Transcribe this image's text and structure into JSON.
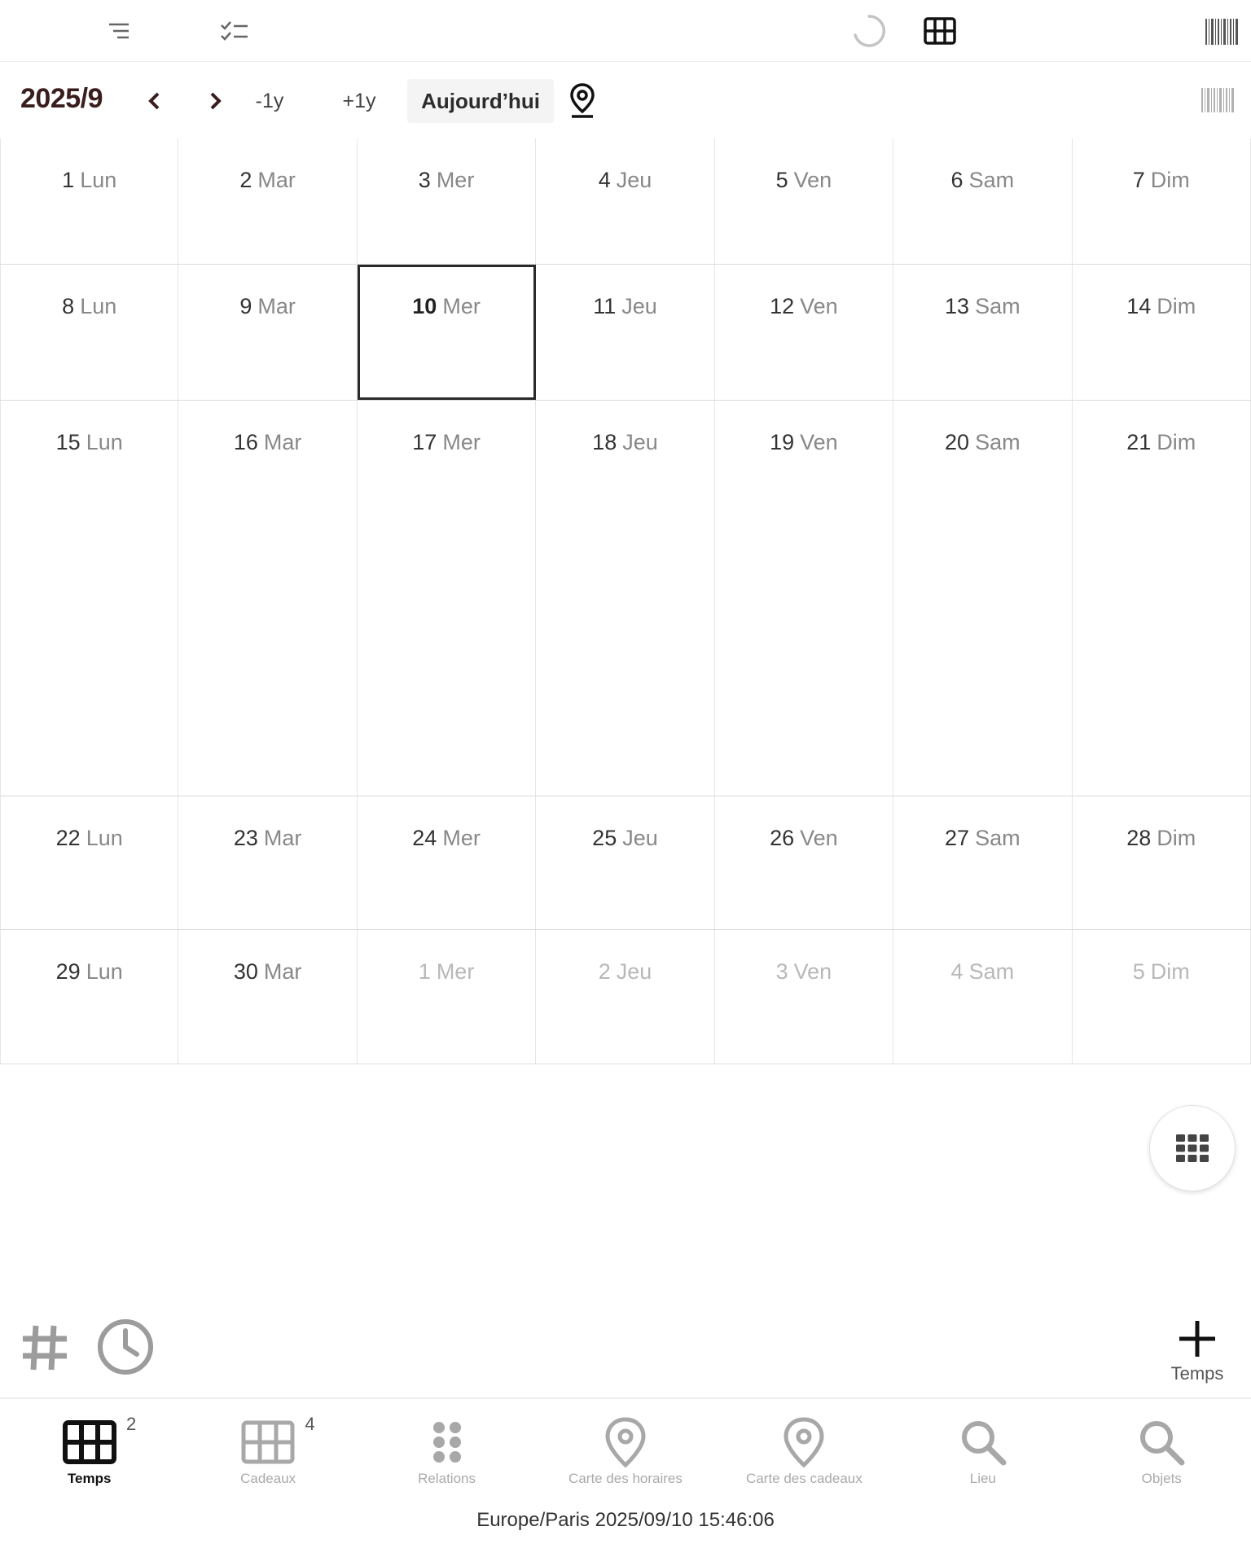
{
  "toolbar": {
    "icons": [
      "list-icon",
      "checklist-icon",
      "loading-spinner-icon",
      "grid-view-icon",
      "barcode-icon"
    ]
  },
  "nav": {
    "month_title": "2025/9",
    "prev_label": "‹",
    "next_label": "›",
    "minus_year": "-1y",
    "plus_year": "+1y",
    "today": "Aujourd’hui"
  },
  "calendar": {
    "weeks": [
      [
        {
          "n": "1",
          "d": "Lun"
        },
        {
          "n": "2",
          "d": "Mar"
        },
        {
          "n": "3",
          "d": "Mer"
        },
        {
          "n": "4",
          "d": "Jeu"
        },
        {
          "n": "5",
          "d": "Ven"
        },
        {
          "n": "6",
          "d": "Sam"
        },
        {
          "n": "7",
          "d": "Dim"
        }
      ],
      [
        {
          "n": "8",
          "d": "Lun"
        },
        {
          "n": "9",
          "d": "Mar"
        },
        {
          "n": "10",
          "d": "Mer",
          "today": true
        },
        {
          "n": "11",
          "d": "Jeu"
        },
        {
          "n": "12",
          "d": "Ven"
        },
        {
          "n": "13",
          "d": "Sam"
        },
        {
          "n": "14",
          "d": "Dim"
        }
      ],
      [
        {
          "n": "15",
          "d": "Lun"
        },
        {
          "n": "16",
          "d": "Mar"
        },
        {
          "n": "17",
          "d": "Mer"
        },
        {
          "n": "18",
          "d": "Jeu"
        },
        {
          "n": "19",
          "d": "Ven"
        },
        {
          "n": "20",
          "d": "Sam"
        },
        {
          "n": "21",
          "d": "Dim"
        }
      ],
      [
        {
          "n": "22",
          "d": "Lun"
        },
        {
          "n": "23",
          "d": "Mar"
        },
        {
          "n": "24",
          "d": "Mer"
        },
        {
          "n": "25",
          "d": "Jeu"
        },
        {
          "n": "26",
          "d": "Ven"
        },
        {
          "n": "27",
          "d": "Sam"
        },
        {
          "n": "28",
          "d": "Dim"
        }
      ],
      [
        {
          "n": "29",
          "d": "Lun"
        },
        {
          "n": "30",
          "d": "Mar"
        },
        {
          "n": "1",
          "d": "Mer",
          "other": true
        },
        {
          "n": "2",
          "d": "Jeu",
          "other": true
        },
        {
          "n": "3",
          "d": "Ven",
          "other": true
        },
        {
          "n": "4",
          "d": "Sam",
          "other": true
        },
        {
          "n": "5",
          "d": "Dim",
          "other": true
        }
      ]
    ]
  },
  "actions": {
    "add_label": "Temps"
  },
  "tabs": [
    {
      "label": "Temps",
      "badge": "2",
      "icon": "grid-icon",
      "active": true
    },
    {
      "label": "Cadeaux",
      "badge": "4",
      "icon": "grid-icon"
    },
    {
      "label": "Relations",
      "badge": "",
      "icon": "dots-icon"
    },
    {
      "label": "Carte des horaires",
      "badge": "",
      "icon": "map-pin-icon"
    },
    {
      "label": "Carte des cadeaux",
      "badge": "",
      "icon": "map-pin-icon"
    },
    {
      "label": "Lieu",
      "badge": "",
      "icon": "search-icon"
    },
    {
      "label": "Objets",
      "badge": "",
      "icon": "search-icon"
    }
  ],
  "status": {
    "timezone_clock": "Europe/Paris 2025/09/10 15:46:06"
  },
  "colors": {
    "title": "#3a1d1d",
    "today_border": "#2a2a2a",
    "muted": "#b8b8b8"
  }
}
